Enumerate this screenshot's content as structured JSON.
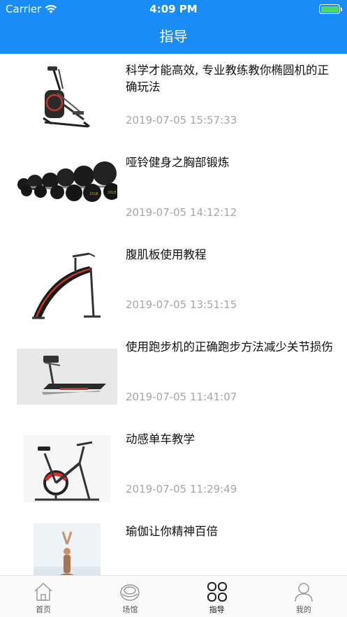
{
  "status_bar": {
    "carrier": "Carrier",
    "time": "4:09 PM"
  },
  "header": {
    "title": "指导"
  },
  "articles": [
    {
      "title": "科学才能高效, 专业教练教你椭圆机的正确玩法",
      "date": "2019-07-05 15:57:33",
      "image_icon": "elliptical-machine"
    },
    {
      "title": "哑铃健身之胸部锻炼",
      "date": "2019-07-05 14:12:12",
      "image_icon": "dumbbells"
    },
    {
      "title": "腹肌板使用教程",
      "date": "2019-07-05 13:51:15",
      "image_icon": "sit-up-bench"
    },
    {
      "title": "使用跑步机的正确跑步方法减少关节损伤",
      "date": "2019-07-05 11:41:07",
      "image_icon": "treadmill"
    },
    {
      "title": "动感单车教学",
      "date": "2019-07-05 11:29:49",
      "image_icon": "spin-bike"
    },
    {
      "title": "瑜伽让你精神百倍",
      "date": "",
      "image_icon": "yoga"
    }
  ],
  "tabbar": {
    "tabs": [
      {
        "label": "首页",
        "icon": "home-icon"
      },
      {
        "label": "场馆",
        "icon": "venue-icon"
      },
      {
        "label": "指导",
        "icon": "guide-icon",
        "active": true
      },
      {
        "label": "我的",
        "icon": "profile-icon"
      }
    ]
  },
  "colors": {
    "header_bg": "#1a8cf8",
    "date_text": "#a7a7a7",
    "battery": "#4cd964"
  }
}
